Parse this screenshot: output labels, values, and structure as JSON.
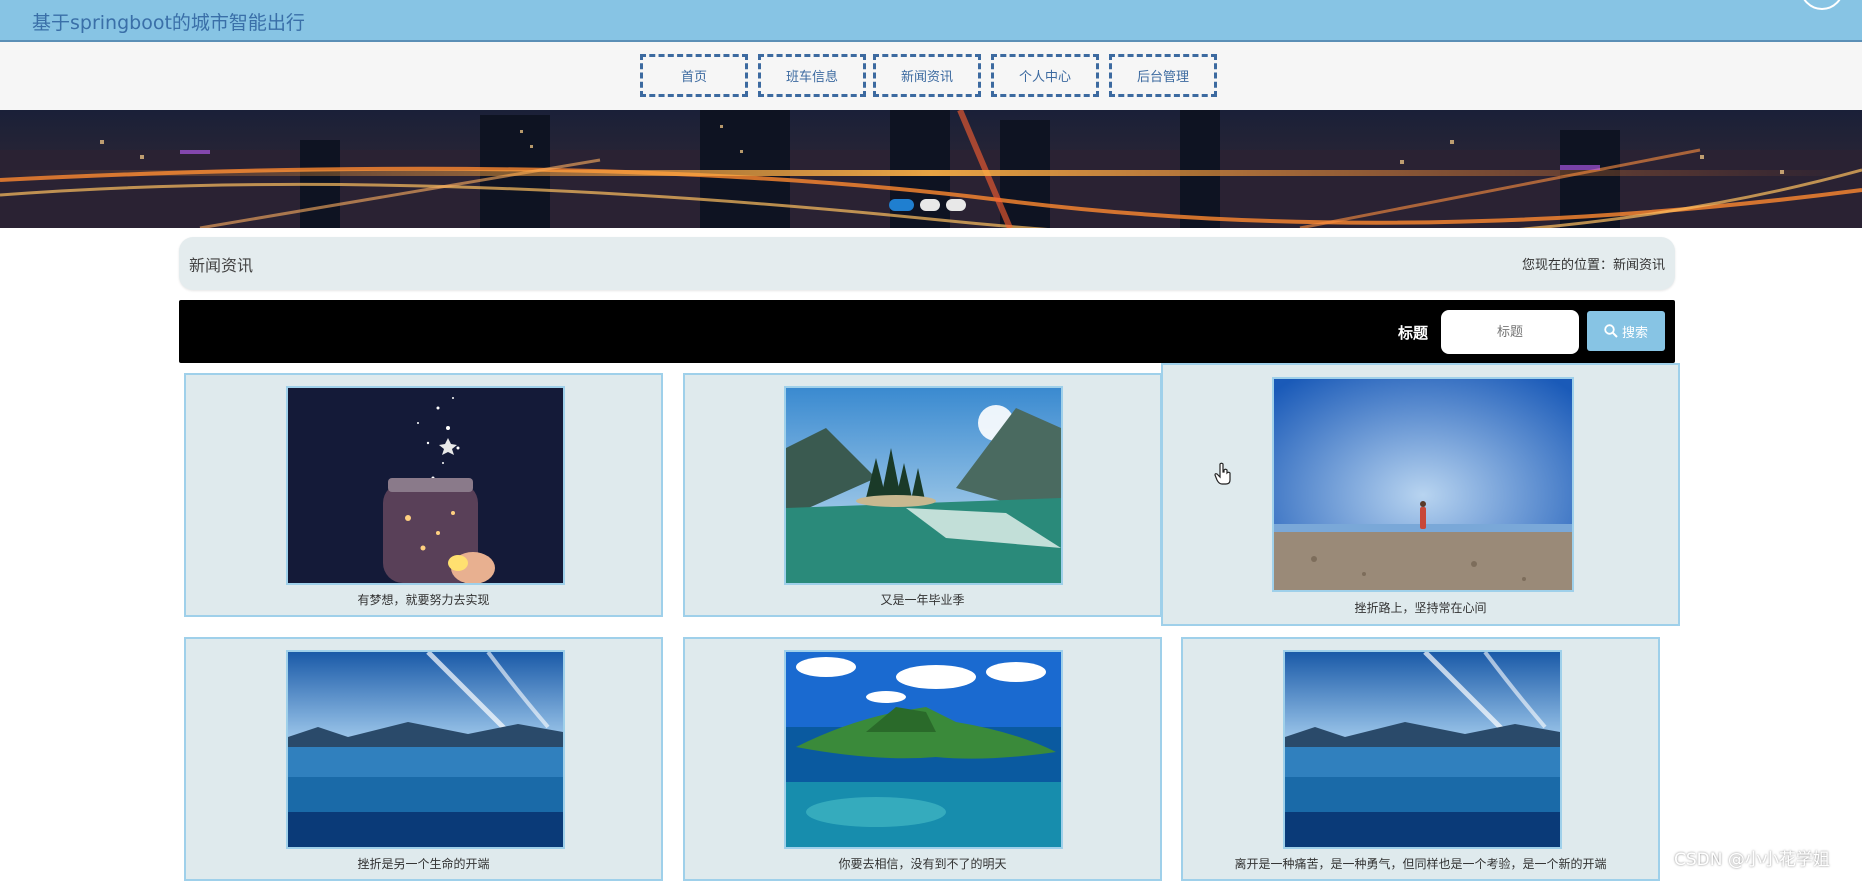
{
  "header": {
    "site_title": "基于springboot的城市智能出行"
  },
  "nav": {
    "items": [
      {
        "label": "首页"
      },
      {
        "label": "班车信息"
      },
      {
        "label": "新闻资讯"
      },
      {
        "label": "个人中心"
      },
      {
        "label": "后台管理"
      }
    ]
  },
  "banner": {
    "slide_count": 3,
    "active_slide": 1
  },
  "breadcrumb": {
    "title": "新闻资讯",
    "position": "您现在的位置：新闻资讯"
  },
  "search": {
    "label": "标题",
    "placeholder": "标题",
    "button_label": "搜索"
  },
  "news": [
    {
      "title": "有梦想，就要努力去实现"
    },
    {
      "title": "又是一年毕业季"
    },
    {
      "title": "挫折路上，坚持常在心间"
    },
    {
      "title": "挫折是另一个生命的开端"
    },
    {
      "title": "你要去相信，没有到不了的明天"
    },
    {
      "title": "离开是一种痛苦，是一种勇气，但同样也是一个考验，是一个新的开端"
    }
  ],
  "watermark": "CSDN @小小花学姐",
  "colors": {
    "header_bg": "#87c4e4",
    "nav_border": "#3c6aa0",
    "card_bg": "#dfeaed",
    "card_border": "#9fd0ea",
    "search_bar_bg": "#000000",
    "search_button_bg": "#87c4e4"
  }
}
